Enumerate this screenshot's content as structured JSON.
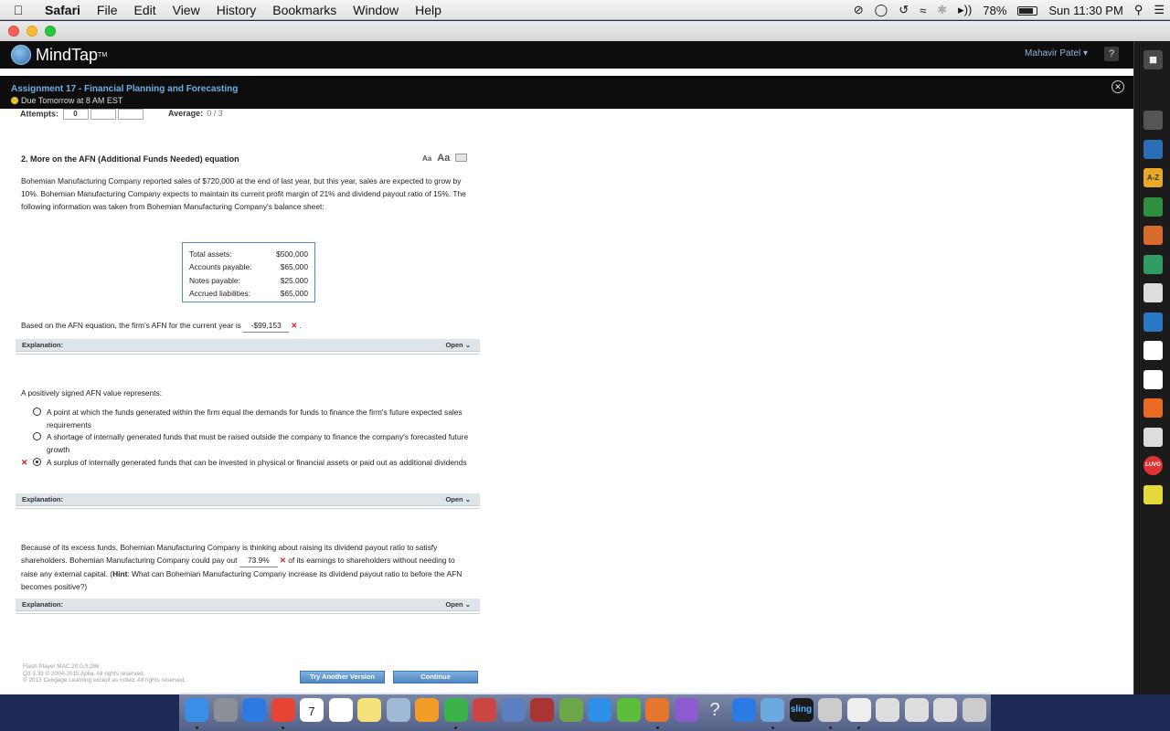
{
  "menubar": {
    "app": "Safari",
    "items": [
      "File",
      "Edit",
      "View",
      "History",
      "Bookmarks",
      "Window",
      "Help"
    ],
    "battery": "78%",
    "clock": "Sun 11:30 PM"
  },
  "mindtap": {
    "logo": "MindTap",
    "user": "Mahavir Patel",
    "help": "?"
  },
  "assignment": {
    "title": "Assignment 17 - Financial Planning and Forecasting",
    "due": "Due Tomorrow at 8 AM EST"
  },
  "attempts": {
    "label": "Attempts:",
    "value": "0",
    "average_label": "Average:",
    "average_value": "0 / 3"
  },
  "question": {
    "title": "2. More on the AFN (Additional Funds Needed) equation",
    "font_small": "Aa",
    "font_large": "Aa",
    "intro": "Bohemian Manufacturing Company reported sales of $720,000 at the end of last year, but this year, sales are expected to grow by 10%. Bohemian Manufacturing Company expects to maintain its current profit margin of 21% and dividend payout ratio of 15%. The following information was taken from Bohemian Manufacturing Company's balance sheet:",
    "balance_sheet": [
      {
        "label": "Total assets:",
        "value": "$500,000"
      },
      {
        "label": "Accounts payable:",
        "value": "$65,000"
      },
      {
        "label": "Notes payable:",
        "value": "$25,000"
      },
      {
        "label": "Accrued liabilities:",
        "value": "$65,000"
      }
    ],
    "afn_prefix": "Based on the AFN equation, the firm's AFN for the current year is",
    "afn_answer": "-$99,153",
    "afn_suffix": ".",
    "explanation_label": "Explanation:",
    "open_label": "Open",
    "mc_prompt": "A positively signed AFN value represents:",
    "mc_options": [
      "A point at which the funds generated within the firm equal the demands for funds to finance the firm's future expected sales requirements",
      "A shortage of internally generated funds that must be raised outside the company to finance the company's forecasted future growth",
      "A surplus of internally generated funds that can be invested in physical or financial assets or paid out as additional dividends"
    ],
    "payout_pre": "Because of its excess funds, Bohemian Manufacturing Company is thinking about raising its dividend payout ratio to satisfy shareholders. Bohemian Manufacturing Company could pay out",
    "payout_answer": "73.9%",
    "payout_post": "of its earnings to shareholders without needing to raise any external capital. (",
    "hint_label": "Hint",
    "hint_text": ": What can Bohemian Manufacturing Company increase its dividend payout ratio to before the AFN becomes positive?)"
  },
  "footer": {
    "line1": "Flash Player MAC 20,0,0,286",
    "line2": "Q3 3.33 © 2004-2015 Aplia. All rights reserved.",
    "line3": "© 2013 Cengage Learning except as noted. All rights reserved.",
    "try_another": "Try Another Version",
    "continue": "Continue"
  },
  "sidebar_icons": [
    "magnifier-icon",
    "book-icon",
    "A-Z",
    "progress-icon",
    "rss-icon",
    "drive-icon",
    "notes-icon",
    "upload-icon",
    "merriam-webster-icon",
    "cengage-icon",
    "feed-icon",
    "edit-icon",
    "LUVO",
    "sticky-icon"
  ],
  "dock_icons": [
    "finder",
    "launchpad",
    "app-store",
    "chrome",
    "calendar",
    "reminders",
    "notes",
    "preview",
    "ibooks",
    "facetime",
    "no-entry",
    "photos",
    "photo-booth",
    "spreadsheet",
    "messages",
    "leaf-app",
    "powerpoint",
    "onenote",
    "help",
    "safari",
    "flux",
    "sling",
    "scanner",
    "preview-2",
    "window-1",
    "window-2",
    "window-3",
    "trash"
  ],
  "dock_calendar_day": "7",
  "dock_sling": "sling",
  "colors": {
    "accent": "#4f88c4",
    "wrong": "#d32020",
    "header": "#0d0d0d"
  }
}
